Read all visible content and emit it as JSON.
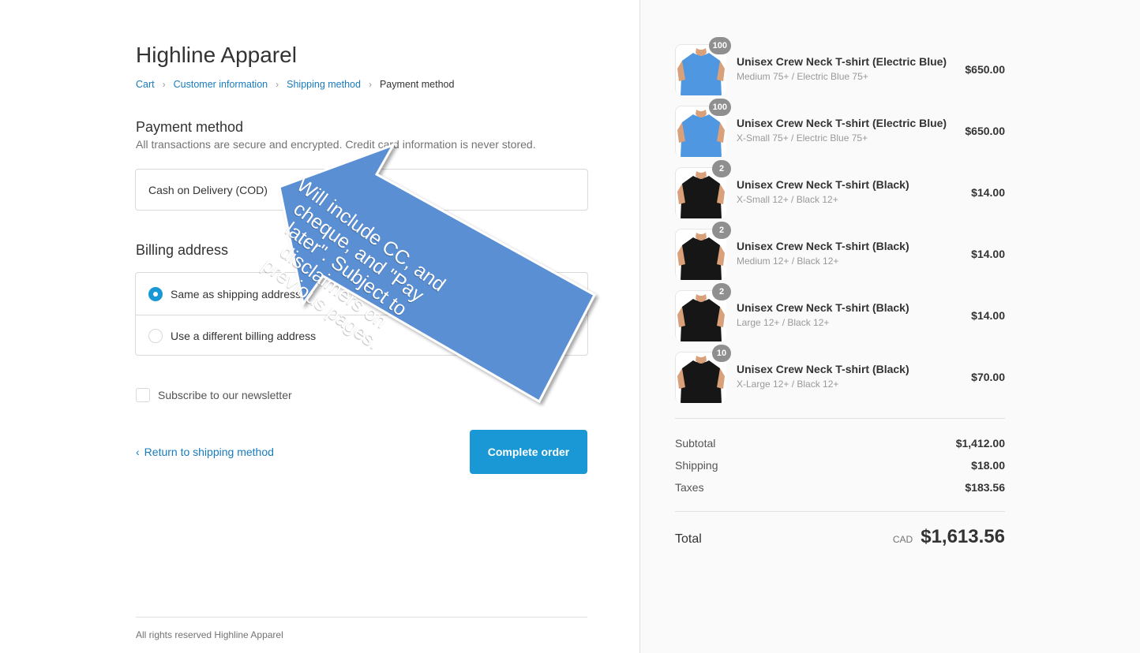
{
  "store": {
    "name": "Highline Apparel"
  },
  "breadcrumb": {
    "items": [
      "Cart",
      "Customer information",
      "Shipping method"
    ],
    "current": "Payment method"
  },
  "payment": {
    "title": "Payment method",
    "subtitle": "All transactions are secure and encrypted. Credit card information is never stored.",
    "option": "Cash on Delivery (COD)"
  },
  "billing": {
    "title": "Billing address",
    "same_label": "Same as shipping address",
    "different_label": "Use a different billing address"
  },
  "newsletter": {
    "label": "Subscribe to our newsletter"
  },
  "actions": {
    "return_label": "Return to shipping method",
    "complete_label": "Complete order"
  },
  "footer": {
    "text": "All rights reserved Highline Apparel"
  },
  "annotation": {
    "text": "Will include CC, and cheque, and \"Pay later\". Subject to disclaimers on previous pages."
  },
  "order": {
    "items": [
      {
        "qty": "100",
        "title": "Unisex Crew Neck T-shirt (Electric Blue)",
        "variant": "Medium 75+ / Electric Blue 75+",
        "price": "$650.00",
        "color": "electric-blue"
      },
      {
        "qty": "100",
        "title": "Unisex Crew Neck T-shirt (Electric Blue)",
        "variant": "X-Small 75+ / Electric Blue 75+",
        "price": "$650.00",
        "color": "electric-blue"
      },
      {
        "qty": "2",
        "title": "Unisex Crew Neck T-shirt (Black)",
        "variant": "X-Small 12+ / Black 12+",
        "price": "$14.00",
        "color": "black"
      },
      {
        "qty": "2",
        "title": "Unisex Crew Neck T-shirt (Black)",
        "variant": "Medium 12+ / Black 12+",
        "price": "$14.00",
        "color": "black"
      },
      {
        "qty": "2",
        "title": "Unisex Crew Neck T-shirt (Black)",
        "variant": "Large 12+ / Black 12+",
        "price": "$14.00",
        "color": "black"
      },
      {
        "qty": "10",
        "title": "Unisex Crew Neck T-shirt (Black)",
        "variant": "X-Large 12+ / Black 12+",
        "price": "$70.00",
        "color": "black"
      }
    ],
    "subtotal_label": "Subtotal",
    "subtotal": "$1,412.00",
    "shipping_label": "Shipping",
    "shipping": "$18.00",
    "taxes_label": "Taxes",
    "taxes": "$183.56",
    "total_label": "Total",
    "currency": "CAD",
    "total": "$1,613.56"
  },
  "colors": {
    "accent": "#1998d5",
    "link": "#197bbd",
    "callout": "#5a8fd4",
    "shirt_blue": "#4f97e0",
    "shirt_black": "#161616"
  }
}
